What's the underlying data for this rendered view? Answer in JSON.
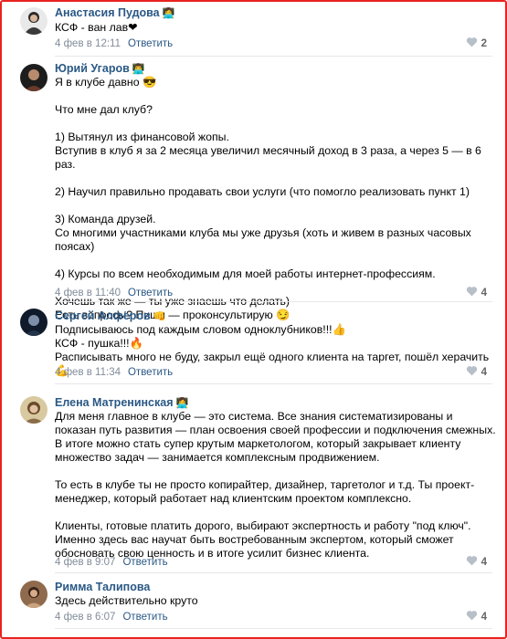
{
  "comments": [
    {
      "author": "Анастасия Пудова",
      "author_emoji": "👩‍💻",
      "text": "КСФ - ван лав❤",
      "date": "4 фев в 12:11",
      "reply": "Ответить",
      "likes": "2"
    },
    {
      "author": "Юрий Угаров",
      "author_emoji": "👨‍💻",
      "text": "Я в клубе давно 😎\n\nЧто мне дал клуб?\n\n1) Вытянул из финансовой жопы.\nВступив в клуб я за 2 месяца увеличил месячный доход в 3 раза, а через 5 — в 6 раз.\n\n2) Научил правильно продавать свои услуги (что помогло реализовать пункт 1)\n\n3) Команда друзей.\nСо многими участниками клуба мы уже друзья (хоть и живем в разных часовых поясах)\n\n4) Курсы по всем необходимым для моей работы интернет-профессиям.\n\nХочешь так же — ты уже знаешь что делать)\nЕсть вопросы? Пиши — проконсультирую 😏",
      "date": "4 фев в 11:40",
      "reply": "Ответить",
      "likes": "4"
    },
    {
      "author": "Сергей Алфёров",
      "author_emoji": "👊",
      "text": "Подписываюсь под каждым словом одноклубников!!!👍\nКСФ - пушка!!!🔥\nРасписывать много не буду, закрыл ещё одного клиента на таргет, пошёл херачить💪",
      "date": "4 фев в 11:34",
      "reply": "Ответить",
      "likes": "4"
    },
    {
      "author": "Елена Матренинская",
      "author_emoji": "👩‍💻",
      "text": "Для меня главное в клубе — это система. Все знания систематизированы и показан путь развития — план освоения своей профессии и подключения смежных. В итоге можно стать супер крутым маркетологом, который закрывает клиенту множество задач — занимается комплексным продвижением.\n\nТо есть в клубе ты не просто копирайтер, дизайнер, таргетолог и т.д. Ты проект-менеджер, который работает над клиентским проектом комплексно.\n\nКлиенты, готовые платить дорого, выбирают экспертность и работу \"под ключ\". Именно здесь вас научат быть востребованным экспертом, который сможет обосновать свою ценность и в итоге усилит бизнес клиента.",
      "date": "4 фев в 9:07",
      "reply": "Ответить",
      "likes": "4"
    },
    {
      "author": "Римма Талипова",
      "author_emoji": "",
      "text": "Здесь действительно круто",
      "date": "4 фев в 6:07",
      "reply": "Ответить",
      "likes": "4"
    }
  ],
  "icons": {
    "like": "heart-icon"
  },
  "colors": {
    "link": "#2a5885",
    "meta": "#818c99",
    "frame": "#e8231e"
  }
}
